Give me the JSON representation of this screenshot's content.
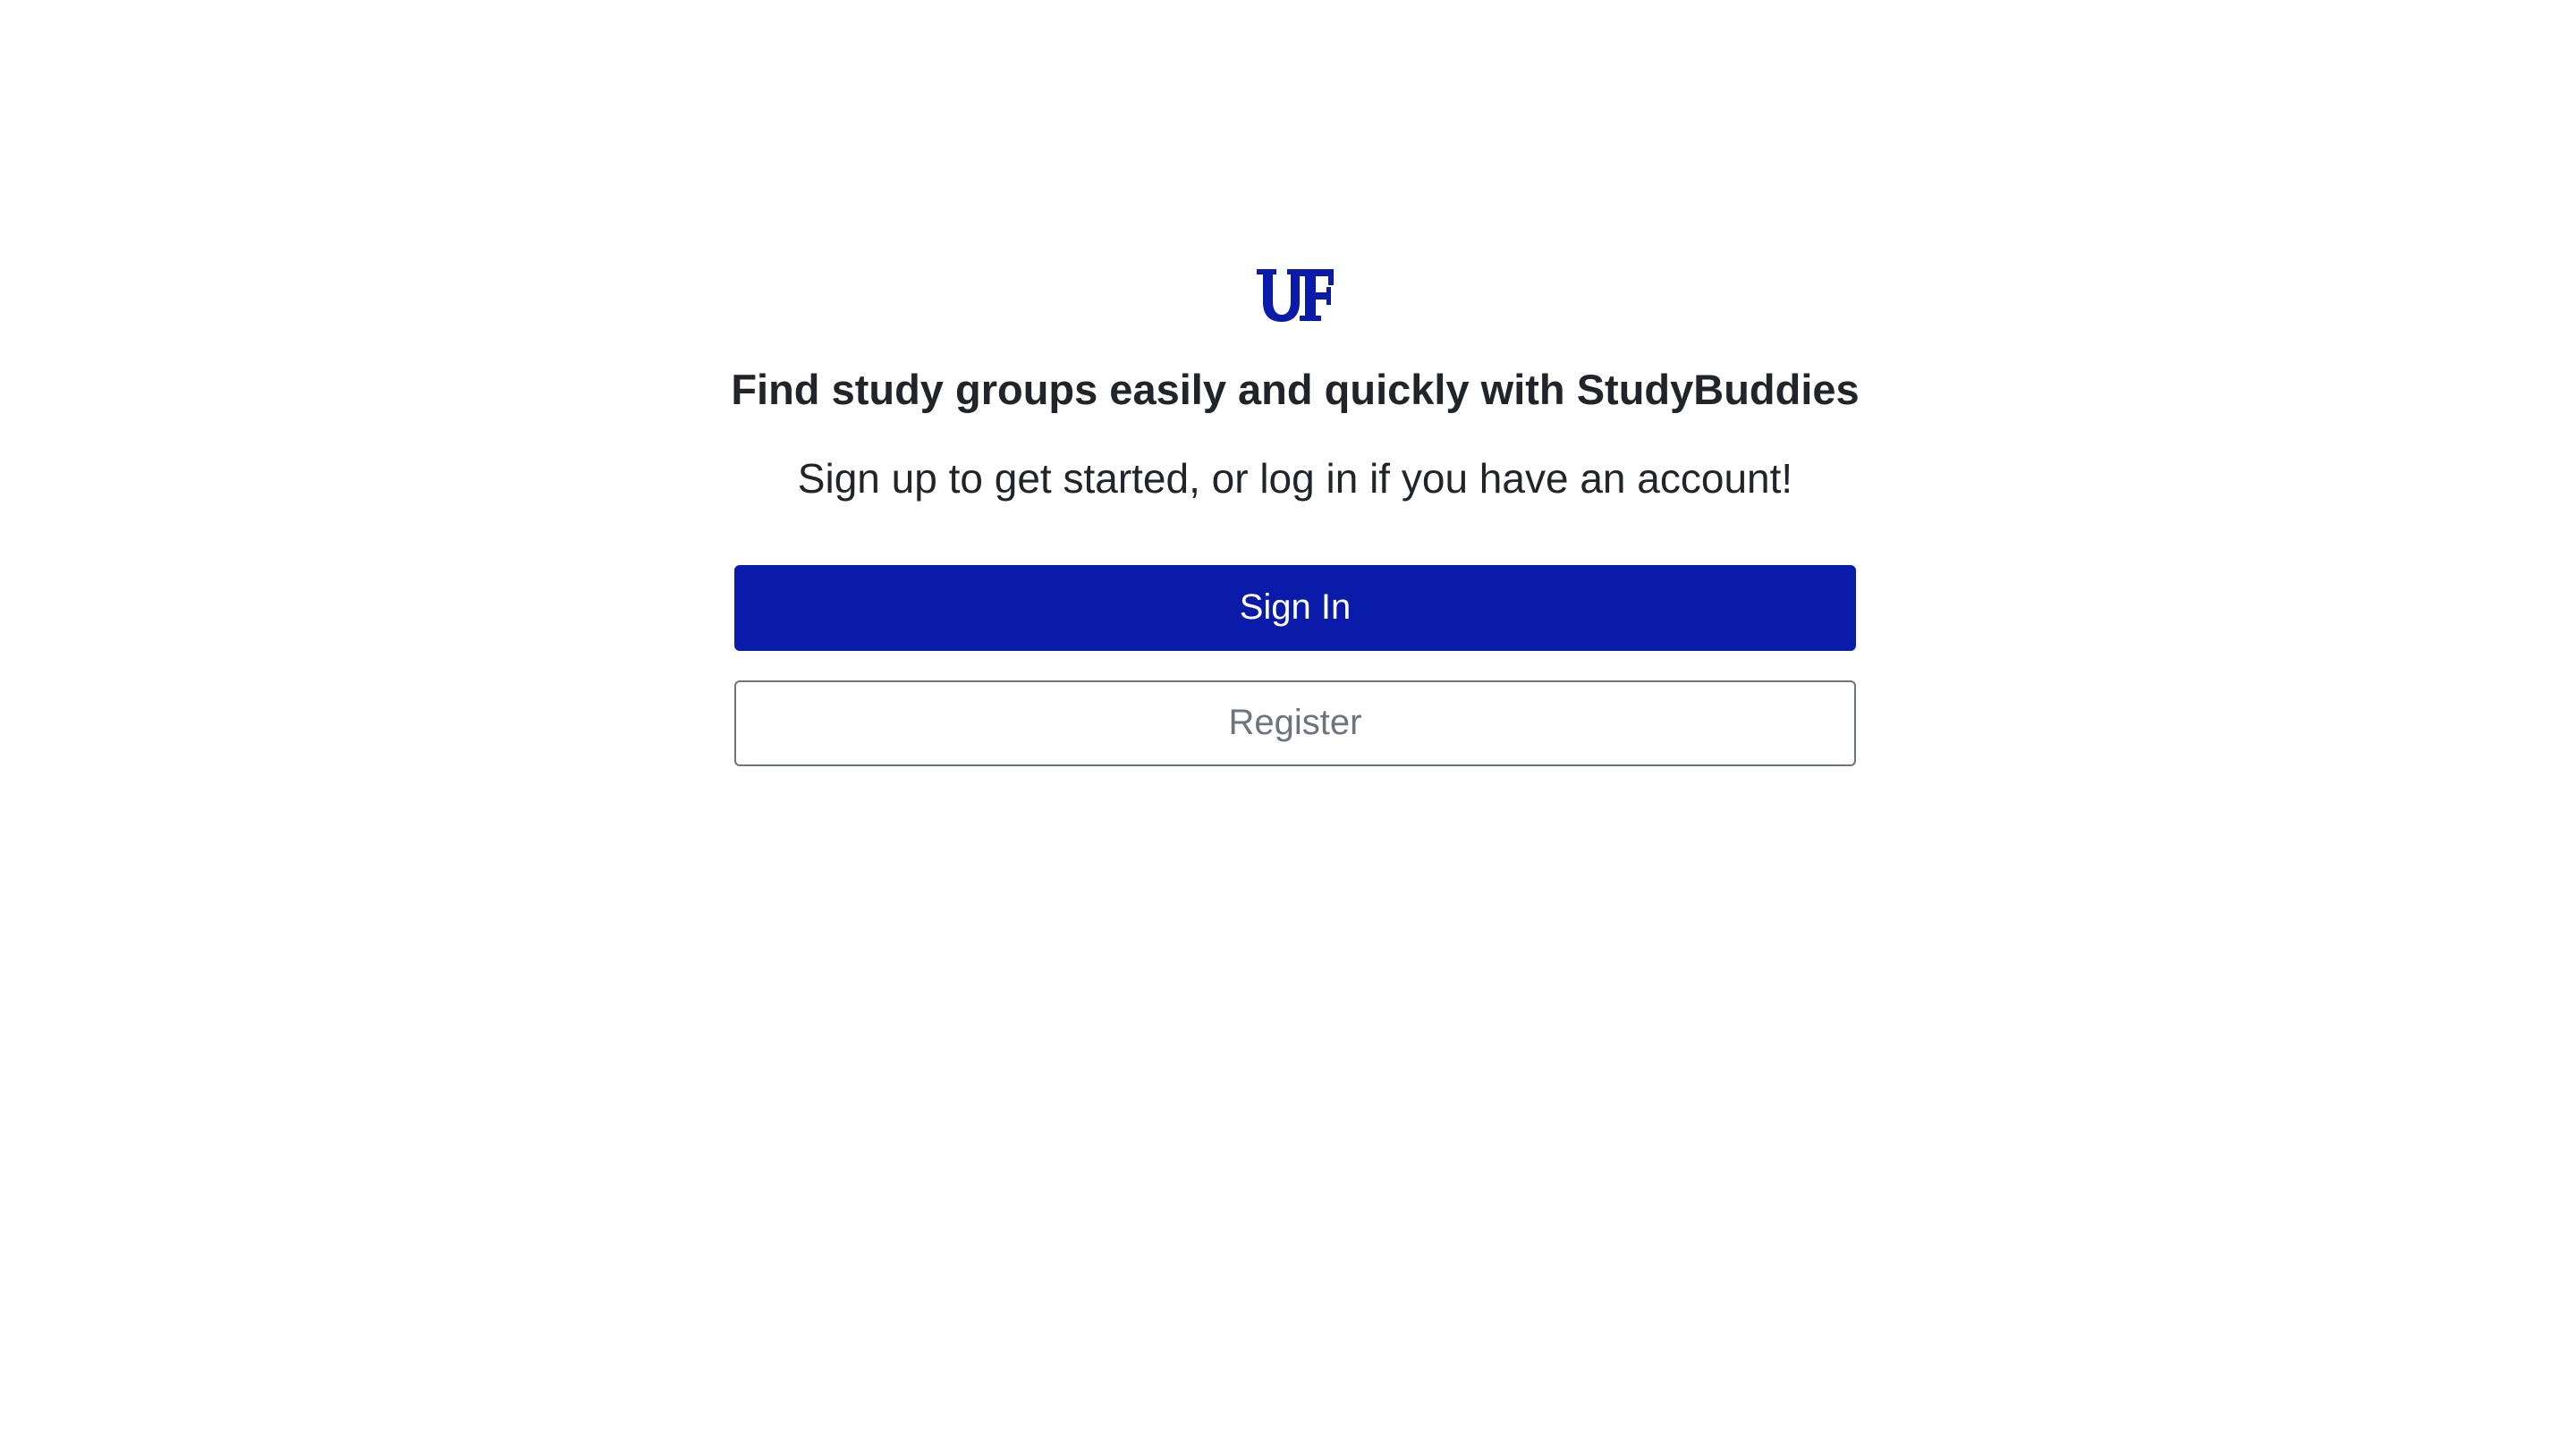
{
  "brand": {
    "logo_text": "UF",
    "logo_color": "#0a1aa9"
  },
  "hero": {
    "headline": "Find study groups easily and quickly with StudyBuddies",
    "subline": "Sign up to get started, or log in if you have an account!"
  },
  "actions": {
    "sign_in_label": "Sign In",
    "register_label": "Register",
    "primary_color": "#0a1aa9",
    "secondary_color": "#6c757d"
  }
}
